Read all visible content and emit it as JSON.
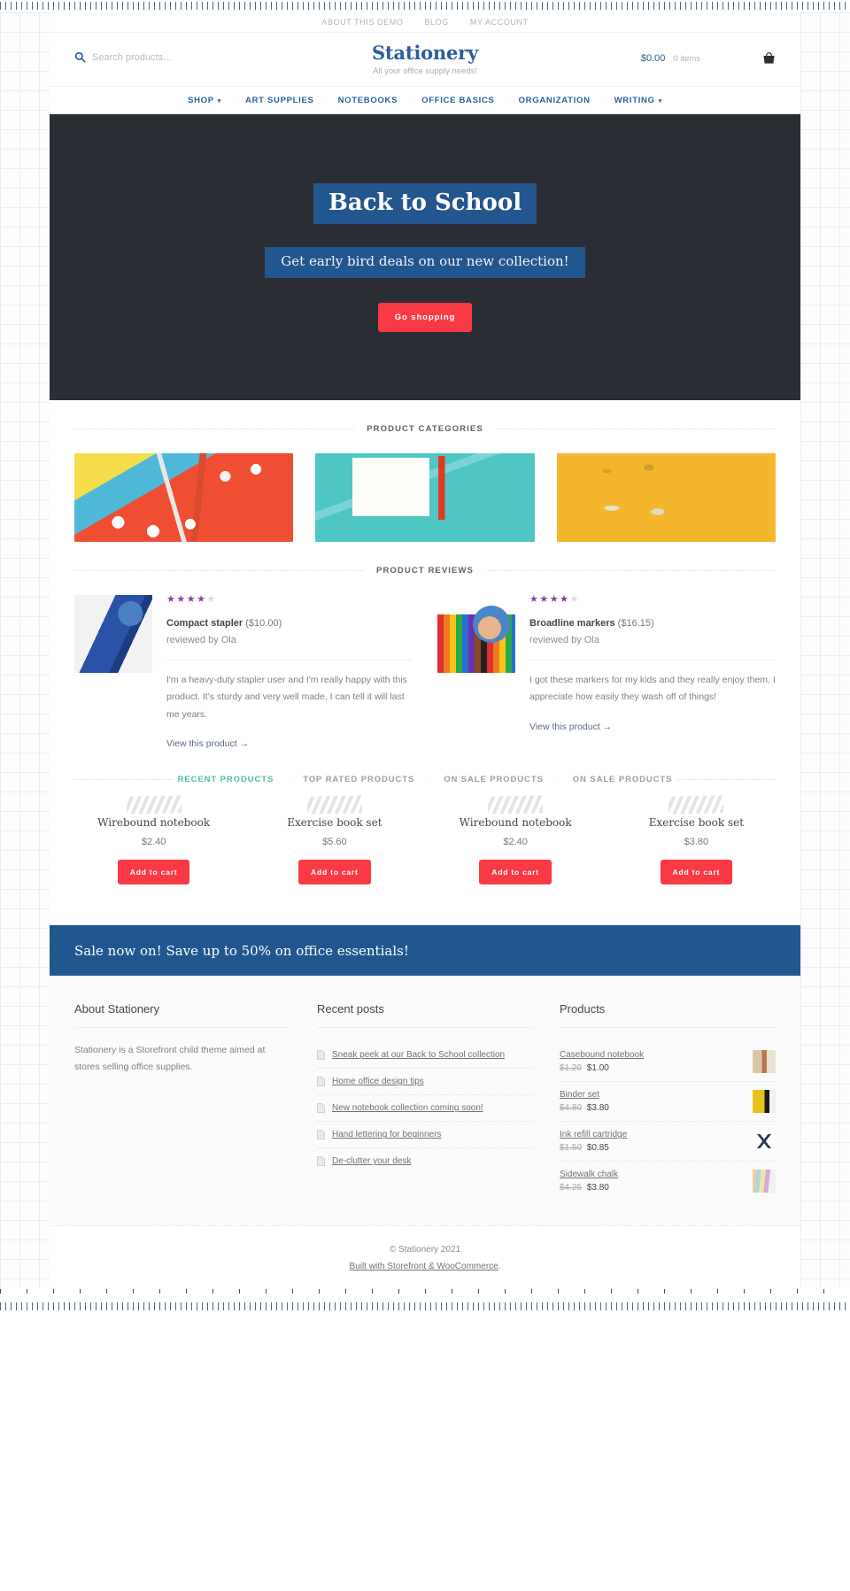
{
  "topbar": {
    "links": [
      {
        "label": "About this demo"
      },
      {
        "label": "Blog"
      },
      {
        "label": "My account"
      }
    ]
  },
  "header": {
    "search_placeholder": "Search products…",
    "search_value": "",
    "brand_title": "Stationery",
    "brand_tagline": "All your office supply needs!",
    "cart_total": "$0.00",
    "cart_count": "0 items"
  },
  "main_nav": {
    "items": [
      {
        "label": "Shop",
        "has_caret": true
      },
      {
        "label": "Art supplies",
        "has_caret": false
      },
      {
        "label": "Notebooks",
        "has_caret": false
      },
      {
        "label": "Office basics",
        "has_caret": false
      },
      {
        "label": "Organization",
        "has_caret": false
      },
      {
        "label": "Writing",
        "has_caret": true
      }
    ],
    "separator": "·",
    "caret": "▾"
  },
  "hero": {
    "title": "Back to School",
    "subtitle": "Get early bird deals on our new collection!",
    "button": "Go shopping",
    "bg_color": "#2b2d34",
    "highlight_color": "#22568f",
    "button_color": "#f93a44"
  },
  "categories_section": {
    "heading": "Product Categories",
    "items": [
      {
        "name": "art-supplies-category"
      },
      {
        "name": "notebooks-category"
      },
      {
        "name": "office-basics-category"
      }
    ]
  },
  "reviews_section": {
    "heading": "Product Reviews",
    "reviews": [
      {
        "stars_filled": 4,
        "stars_total": 5,
        "product": "Compact stapler",
        "price": "($10.00)",
        "byline": "reviewed by Ola",
        "text": "I'm a heavy-duty stapler user and I'm really happy with this product. It's sturdy and very well made, I can tell it will last me years.",
        "link": "View this product →"
      },
      {
        "stars_filled": 4,
        "stars_total": 5,
        "product": "Broadline markers",
        "price": "($16.15)",
        "byline": "reviewed by Ola",
        "text": "I got these markers for my kids and they really enjoy them. I appreciate how easily they wash off of things!",
        "link": "View this product →"
      }
    ]
  },
  "product_tabs": {
    "tabs": [
      {
        "label": "Recent products",
        "active": true
      },
      {
        "label": "Top rated products",
        "active": false
      },
      {
        "label": "On sale products",
        "active": false
      },
      {
        "label": "On sale products",
        "active": false
      }
    ],
    "separator": "·",
    "active_color": "#49bfa8"
  },
  "products": {
    "add_to_cart_label": "Add to cart",
    "items": [
      {
        "name": "Wirebound notebook",
        "price": "$2.40",
        "style": "teal"
      },
      {
        "name": "Exercise book set",
        "price": "$5.60",
        "style": "coral"
      },
      {
        "name": "Wirebound notebook",
        "price": "$2.40",
        "style": "blue"
      },
      {
        "name": "Exercise book set",
        "price": "$3.80",
        "style": "lilac"
      }
    ]
  },
  "sale_banner": {
    "text": "Sale now on! Save up to 50% on office essentials!",
    "bg_color": "#22568f"
  },
  "footer": {
    "about": {
      "title": "About Stationery",
      "text": "Stationery is a Storefront child theme aimed at stores selling office supplies."
    },
    "recent_posts": {
      "title": "Recent posts",
      "items": [
        {
          "label": "Sneak peek at our Back to School collection"
        },
        {
          "label": "Home office design tips"
        },
        {
          "label": "New notebook collection coming soon!"
        },
        {
          "label": "Hand lettering for beginners"
        },
        {
          "label": "De-clutter your desk"
        }
      ]
    },
    "products": {
      "title": "Products",
      "items": [
        {
          "name": "Casebound notebook",
          "old_price": "$1.20",
          "new_price": "$1.00",
          "thumb": "pt-casebound"
        },
        {
          "name": "Binder set",
          "old_price": "$4.80",
          "new_price": "$3.80",
          "thumb": "pt-binder"
        },
        {
          "name": "Ink refill cartridge",
          "old_price": "$1.50",
          "new_price": "$0.85",
          "thumb": "pt-ink"
        },
        {
          "name": "Sidewalk chalk",
          "old_price": "$4.25",
          "new_price": "$3.80",
          "thumb": "pt-chalk"
        }
      ]
    }
  },
  "credits": {
    "copyright": "© Stationery 2021",
    "built_with": "Built with Storefront & WooCommerce",
    "built_with_suffix": "."
  }
}
